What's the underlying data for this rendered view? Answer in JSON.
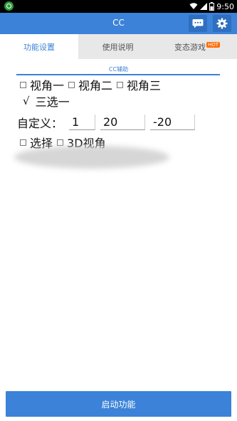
{
  "status": {
    "time": "9:50"
  },
  "app": {
    "title": "CC"
  },
  "tabs": [
    {
      "label": "功能设置"
    },
    {
      "label": "使用说明"
    },
    {
      "label": "变态游戏",
      "badge": "HOT"
    }
  ],
  "section": {
    "label": "CC辅助"
  },
  "options": {
    "view1": "视角一",
    "view2": "视角二",
    "view3": "视角三",
    "pick_mark": "√",
    "pick_label": "三选一",
    "custom_label": "自定义：",
    "custom_values": [
      "1",
      "20",
      "-20"
    ],
    "select_label": "选择",
    "view3d_label": "3D视角"
  },
  "bottom": {
    "start_label": "启动功能"
  },
  "colors": {
    "accent": "#3b82d8",
    "badge": "#ff6a00"
  }
}
